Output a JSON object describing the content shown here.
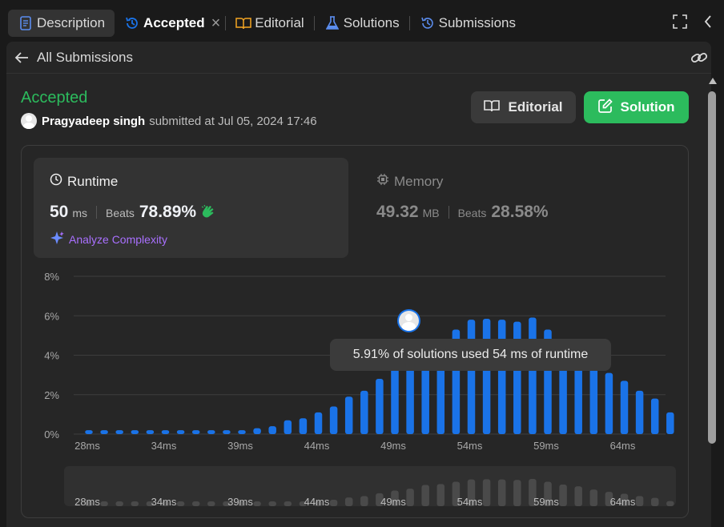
{
  "tabs": [
    {
      "label": "Description",
      "icon": "document-icon"
    },
    {
      "label": "Accepted",
      "icon": "history-icon"
    },
    {
      "label": "Editorial",
      "icon": "book-icon"
    },
    {
      "label": "Solutions",
      "icon": "flask-icon"
    },
    {
      "label": "Submissions",
      "icon": "history-icon"
    }
  ],
  "subbar": {
    "back_label": "All Submissions"
  },
  "submission": {
    "status": "Accepted",
    "user": "Pragyadeep singh",
    "submitted_text": "submitted at Jul 05, 2024 17:46"
  },
  "buttons": {
    "editorial": "Editorial",
    "solution": "Solution"
  },
  "runtime": {
    "title": "Runtime",
    "value": "50",
    "unit": "ms",
    "beats_label": "Beats",
    "beats_pct": "78.89%"
  },
  "memory": {
    "title": "Memory",
    "value": "49.32",
    "unit": "MB",
    "beats_label": "Beats",
    "beats_pct": "28.58%"
  },
  "analyze_label": "Analyze Complexity",
  "tooltip": "5.91% of solutions used 54 ms of runtime",
  "colors": {
    "accepted": "#2cbb5d",
    "bar": "#1a73e8",
    "bar_muted": "#4a4a4a",
    "purple": "#a970ff"
  },
  "chart_data": {
    "type": "bar",
    "ylim": [
      0,
      8
    ],
    "yticks": [
      "0%",
      "2%",
      "4%",
      "6%",
      "8%"
    ],
    "x": [
      28,
      29,
      30,
      31,
      32,
      33,
      34,
      35,
      36,
      37,
      38,
      39,
      40,
      41,
      42,
      43,
      44,
      45,
      46,
      47,
      48,
      49,
      50,
      51,
      52,
      53,
      54,
      55,
      56,
      57,
      58,
      59,
      60,
      61,
      62,
      63,
      64,
      65,
      66
    ],
    "xtick_labels": [
      "28ms",
      "34ms",
      "39ms",
      "44ms",
      "49ms",
      "54ms",
      "59ms",
      "64ms"
    ],
    "xtick_values": [
      28,
      33,
      38,
      43,
      48,
      53,
      58,
      63
    ],
    "values": [
      0.2,
      0.2,
      0.2,
      0.2,
      0.2,
      0.2,
      0.2,
      0.2,
      0.2,
      0.2,
      0.2,
      0.3,
      0.4,
      0.7,
      0.8,
      1.1,
      1.4,
      1.9,
      2.2,
      2.8,
      3.4,
      3.8,
      4.6,
      4.8,
      5.3,
      5.8,
      5.85,
      5.8,
      5.7,
      5.91,
      5.3,
      4.7,
      4.3,
      3.6,
      3.1,
      2.7,
      2.2,
      1.8,
      1.1
    ],
    "highlight_x": 54
  }
}
